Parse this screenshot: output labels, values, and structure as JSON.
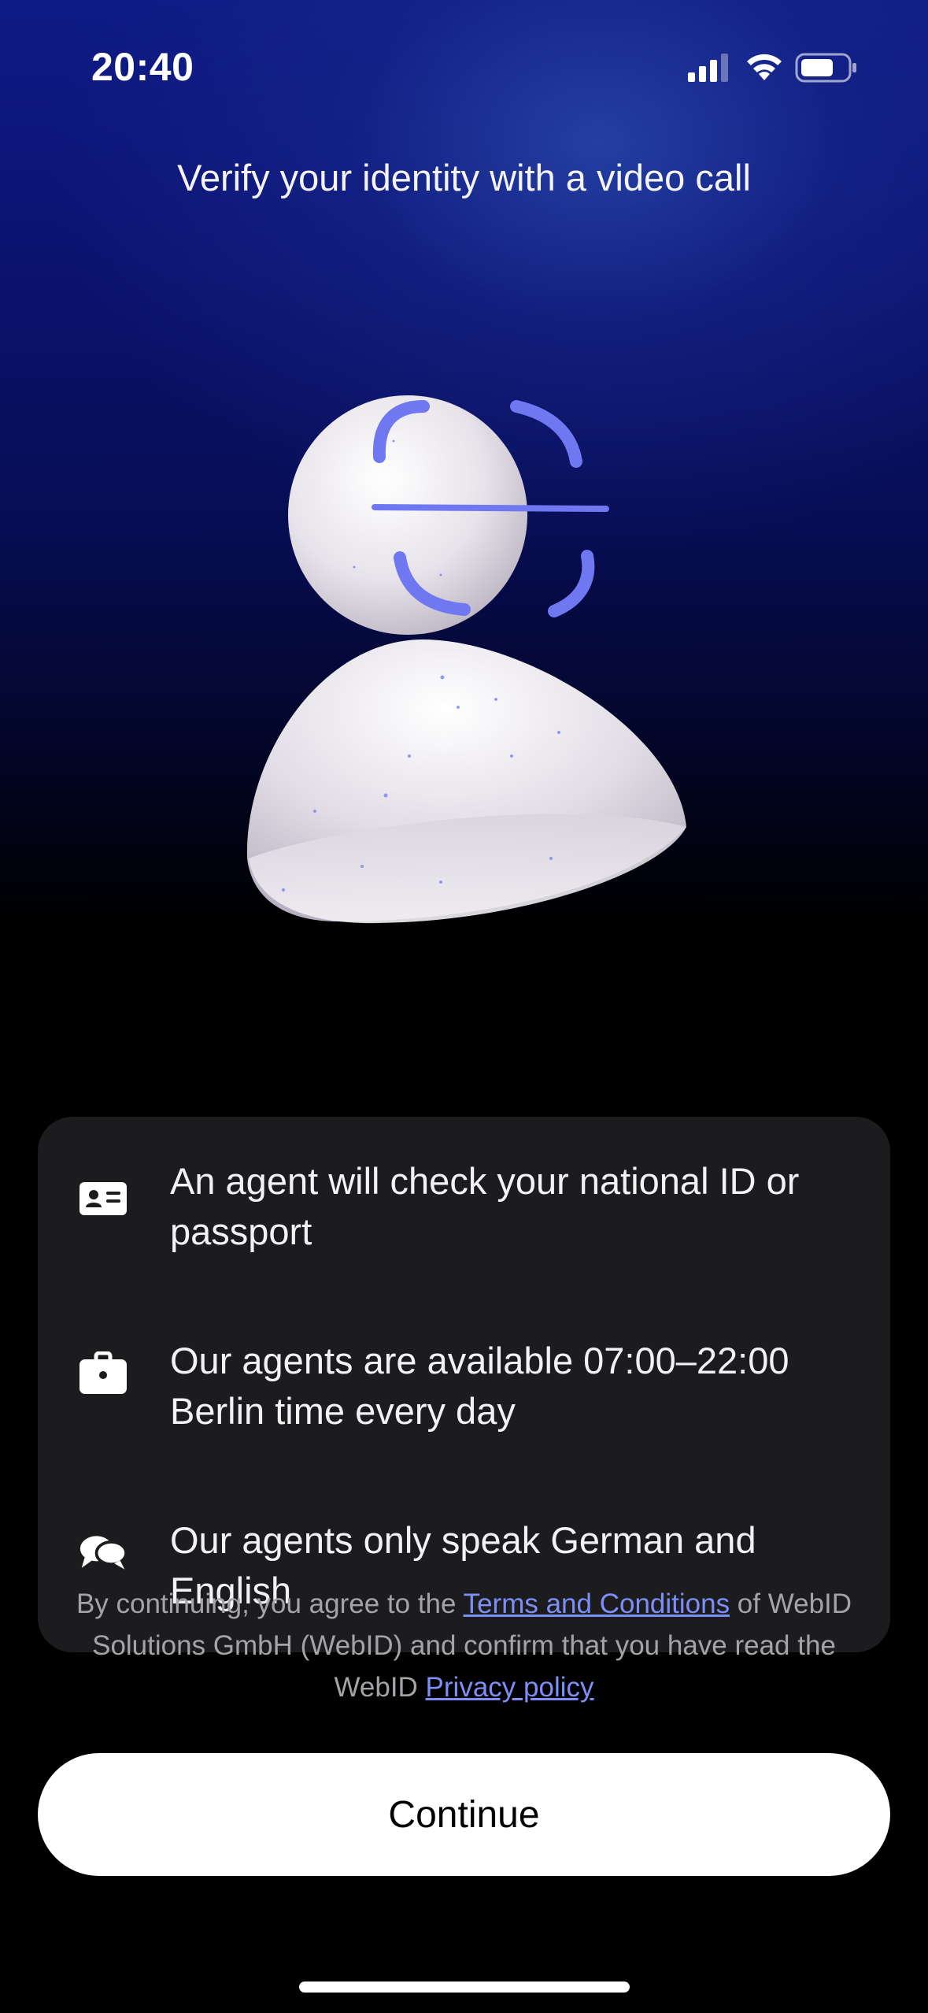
{
  "status_bar": {
    "time": "20:40"
  },
  "title": "Verify your identity with a video call",
  "info_items": [
    {
      "icon": "id-card-icon",
      "text": "An agent will check your national ID or passport"
    },
    {
      "icon": "briefcase-icon",
      "text": "Our agents are available 07:00–22:00 Berlin time every day"
    },
    {
      "icon": "chat-bubbles-icon",
      "text": "Our agents only speak German and English"
    }
  ],
  "legal": {
    "prefix": "By continuing, you agree to the ",
    "terms_link": "Terms and Conditions",
    "middle": " of WebID Solutions GmbH (WebID) and confirm that you have read the WebID ",
    "privacy_link": "Privacy policy"
  },
  "continue_label": "Continue",
  "colors": {
    "accent": "#7d8ff6",
    "card": "#1c1c1e",
    "background_top": "#0e1a86"
  }
}
